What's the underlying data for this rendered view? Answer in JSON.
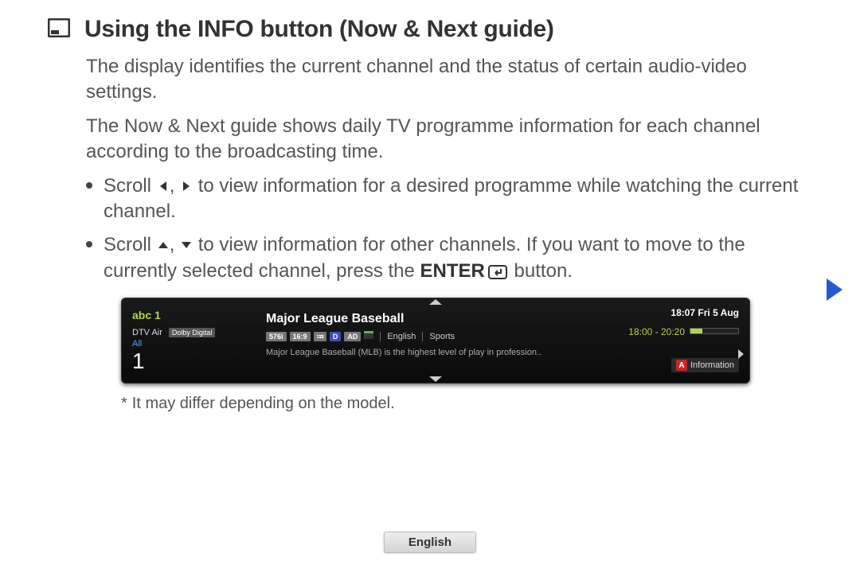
{
  "title": "Using the INFO button (Now & Next guide)",
  "para1": "The display identifies the current channel and the status of certain audio-video settings.",
  "para2": "The Now & Next guide shows daily TV programme information for each channel according to the broadcasting time.",
  "bullets": {
    "b1_pre": "Scroll ",
    "b1_mid": " to view information for a desired programme while watching the current channel.",
    "b2_pre": "Scroll ",
    "b2_mid": " to view information for other channels. If you want to move to the currently selected channel, press the ",
    "b2_enter": "ENTER",
    "b2_post": " button."
  },
  "osd": {
    "channel_name": "abc 1",
    "signal": "DTV Air",
    "dolby": "Dolby Digital",
    "all": "All",
    "channel_number": "1",
    "programme_title": "Major League Baseball",
    "badges": {
      "res": "576i",
      "ratio": "16:9",
      "d": "D",
      "ad": "AD"
    },
    "lang": "English",
    "genre": "Sports",
    "description": "Major League Baseball (MLB) is the highest level of play in profession..",
    "clock": "18:07 Fri 5 Aug",
    "timespan": "18:00 - 20:20",
    "info_label": "Information",
    "info_key": "A"
  },
  "note_star": "*",
  "note": "It may differ depending on the model.",
  "lang_tab": "English",
  "glyphs": {
    "comma": ", "
  }
}
